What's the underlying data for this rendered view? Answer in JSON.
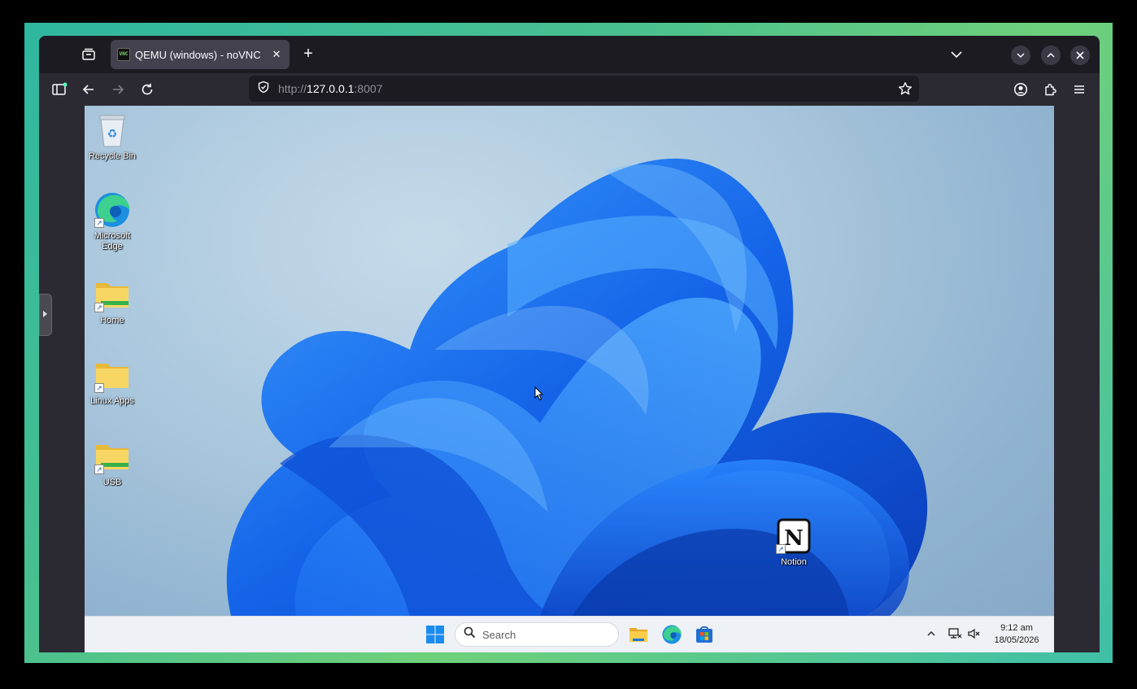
{
  "browser": {
    "tab": {
      "title": "QEMU (windows) - noVNC",
      "favicon_text": "VNC"
    },
    "url": {
      "scheme": "http://",
      "host": "127.0.0.1",
      "port": ":8007"
    }
  },
  "desktop": {
    "icons": [
      {
        "label": "Recycle Bin"
      },
      {
        "label": "Microsoft Edge"
      },
      {
        "label": "Home"
      },
      {
        "label": "Linux Apps"
      },
      {
        "label": "USB"
      },
      {
        "label": "Notion"
      }
    ]
  },
  "taskbar": {
    "search_placeholder": "Search",
    "time": "9:12 am",
    "date": "18/05/2026"
  },
  "colors": {
    "accent": "#0067c0",
    "wallpaper_blue": "#1565e6",
    "host_green": "#49c08f"
  }
}
